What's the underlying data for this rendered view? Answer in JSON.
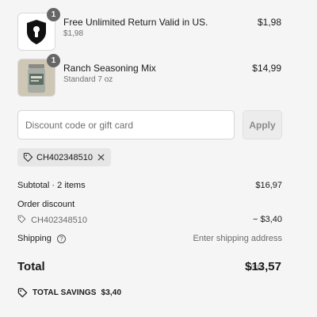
{
  "items": [
    {
      "name": "Free Unlimited Return Valid in US.",
      "subtitle": "$1,98",
      "price": "$1,98",
      "quantity": "1",
      "icon": "keyhole-shield-icon"
    },
    {
      "name": "Ranch Seasoning Mix",
      "subtitle": "Standard 7 oz",
      "price": "$14,99",
      "quantity": "1",
      "icon": "seasoning-jar-photo"
    }
  ],
  "discount": {
    "placeholder": "Discount code or gift card",
    "apply_label": "Apply",
    "applied_code": "CH402348510"
  },
  "summary": {
    "subtotal_label": "Subtotal · 2 items",
    "subtotal_value": "$16,97",
    "order_discount_label": "Order discount",
    "discount_code": "CH402348510",
    "discount_value": "− $3,40",
    "shipping_label": "Shipping",
    "shipping_value": "Enter shipping address",
    "total_label": "Total",
    "currency": "USD",
    "total_value": "$13,57",
    "savings_label": "TOTAL SAVINGS",
    "savings_value": "$3,40"
  },
  "colors": {
    "background": "#f5f5f5",
    "badge": "#666666",
    "muted_text": "#6b6b6b"
  }
}
